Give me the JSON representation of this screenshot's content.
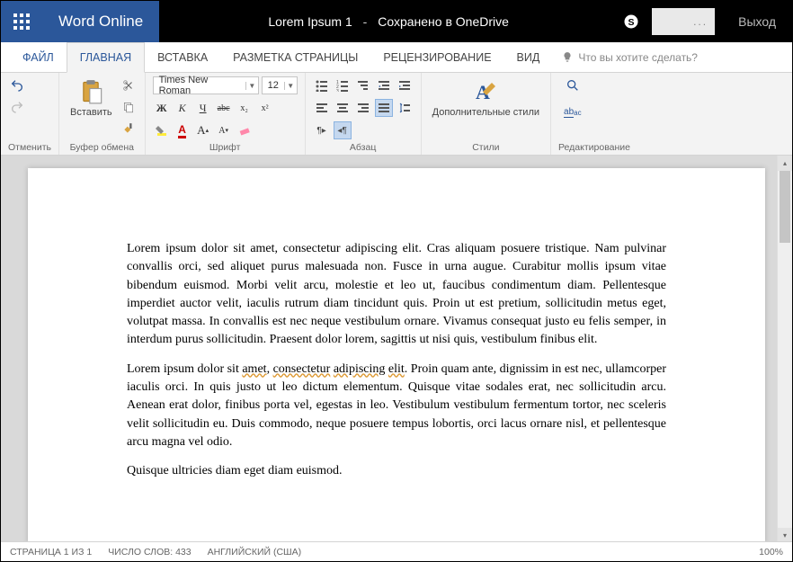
{
  "title": {
    "app": "Word Online",
    "doc": "Lorem Ipsum 1",
    "saved": "Сохранено в OneDrive",
    "user": "...",
    "logout": "Выход"
  },
  "tabs": {
    "file": "ФАЙЛ",
    "home": "ГЛАВНАЯ",
    "insert": "ВСТАВКА",
    "layout": "РАЗМЕТКА СТРАНИЦЫ",
    "review": "РЕЦЕНЗИРОВАНИЕ",
    "view": "ВИД",
    "tellme": "Что вы хотите сделать?"
  },
  "ribbon": {
    "undo_label": "Отменить",
    "clipboard_label": "Буфер обмена",
    "paste": "Вставить",
    "font_label": "Шрифт",
    "font_name": "Times New Roman",
    "font_size": "12",
    "bold": "Ж",
    "italic": "К",
    "underline": "Ч",
    "strike": "abc",
    "sub": "x₂",
    "sup": "x²",
    "grow": "A",
    "shrink": "A",
    "para_label": "Абзац",
    "styles_label": "Стили",
    "styles_btn": "Дополнительные стили",
    "editing_label": "Редактирование",
    "replace": "ab"
  },
  "doc": {
    "p1": "Lorem ipsum dolor sit amet, consectetur adipiscing elit. Cras aliquam posuere tristique. Nam pulvinar convallis orci, sed aliquet purus malesuada non. Fusce in urna augue. Curabitur mollis ipsum vitae bibendum euismod. Morbi velit arcu, molestie et leo ut, faucibus condimentum diam. Pellentesque imperdiet auctor velit, iaculis rutrum diam tincidunt quis. Proin ut est pretium, sollicitudin metus eget, volutpat massa. In convallis est nec neque vestibulum ornare. Vivamus consequat justo eu felis semper, in interdum purus sollicitudin. Praesent dolor lorem, sagittis ut nisi quis, vestibulum finibus elit.",
    "p2a": "Lorem ipsum dolor sit ",
    "p2sq1": "amet",
    "p2b": ", ",
    "p2sq2": "consectetur",
    "p2c": " ",
    "p2sq3": "adipiscing",
    "p2d": " ",
    "p2sq4": "elit",
    "p2e": ". Proin quam ante, dignissim in est nec, ullamcorper iaculis orci. In quis justo ut leo dictum elementum. Quisque vitae sodales erat, nec sollicitudin arcu. Aenean erat dolor, finibus porta vel, egestas in leo. Vestibulum vestibulum fermentum tortor, nec sceleris velit sollicitudin eu. Duis commodo, neque posuere tempus lobortis, orci lacus ornare nisl, et pellentesque arcu magna vel odio.",
    "p3": "Quisque ultricies diam eget diam euismod."
  },
  "status": {
    "page": "СТРАНИЦА 1 ИЗ 1",
    "words": "ЧИСЛО СЛОВ: 433",
    "lang": "АНГЛИЙСКИЙ (США)",
    "zoom": "100%"
  }
}
